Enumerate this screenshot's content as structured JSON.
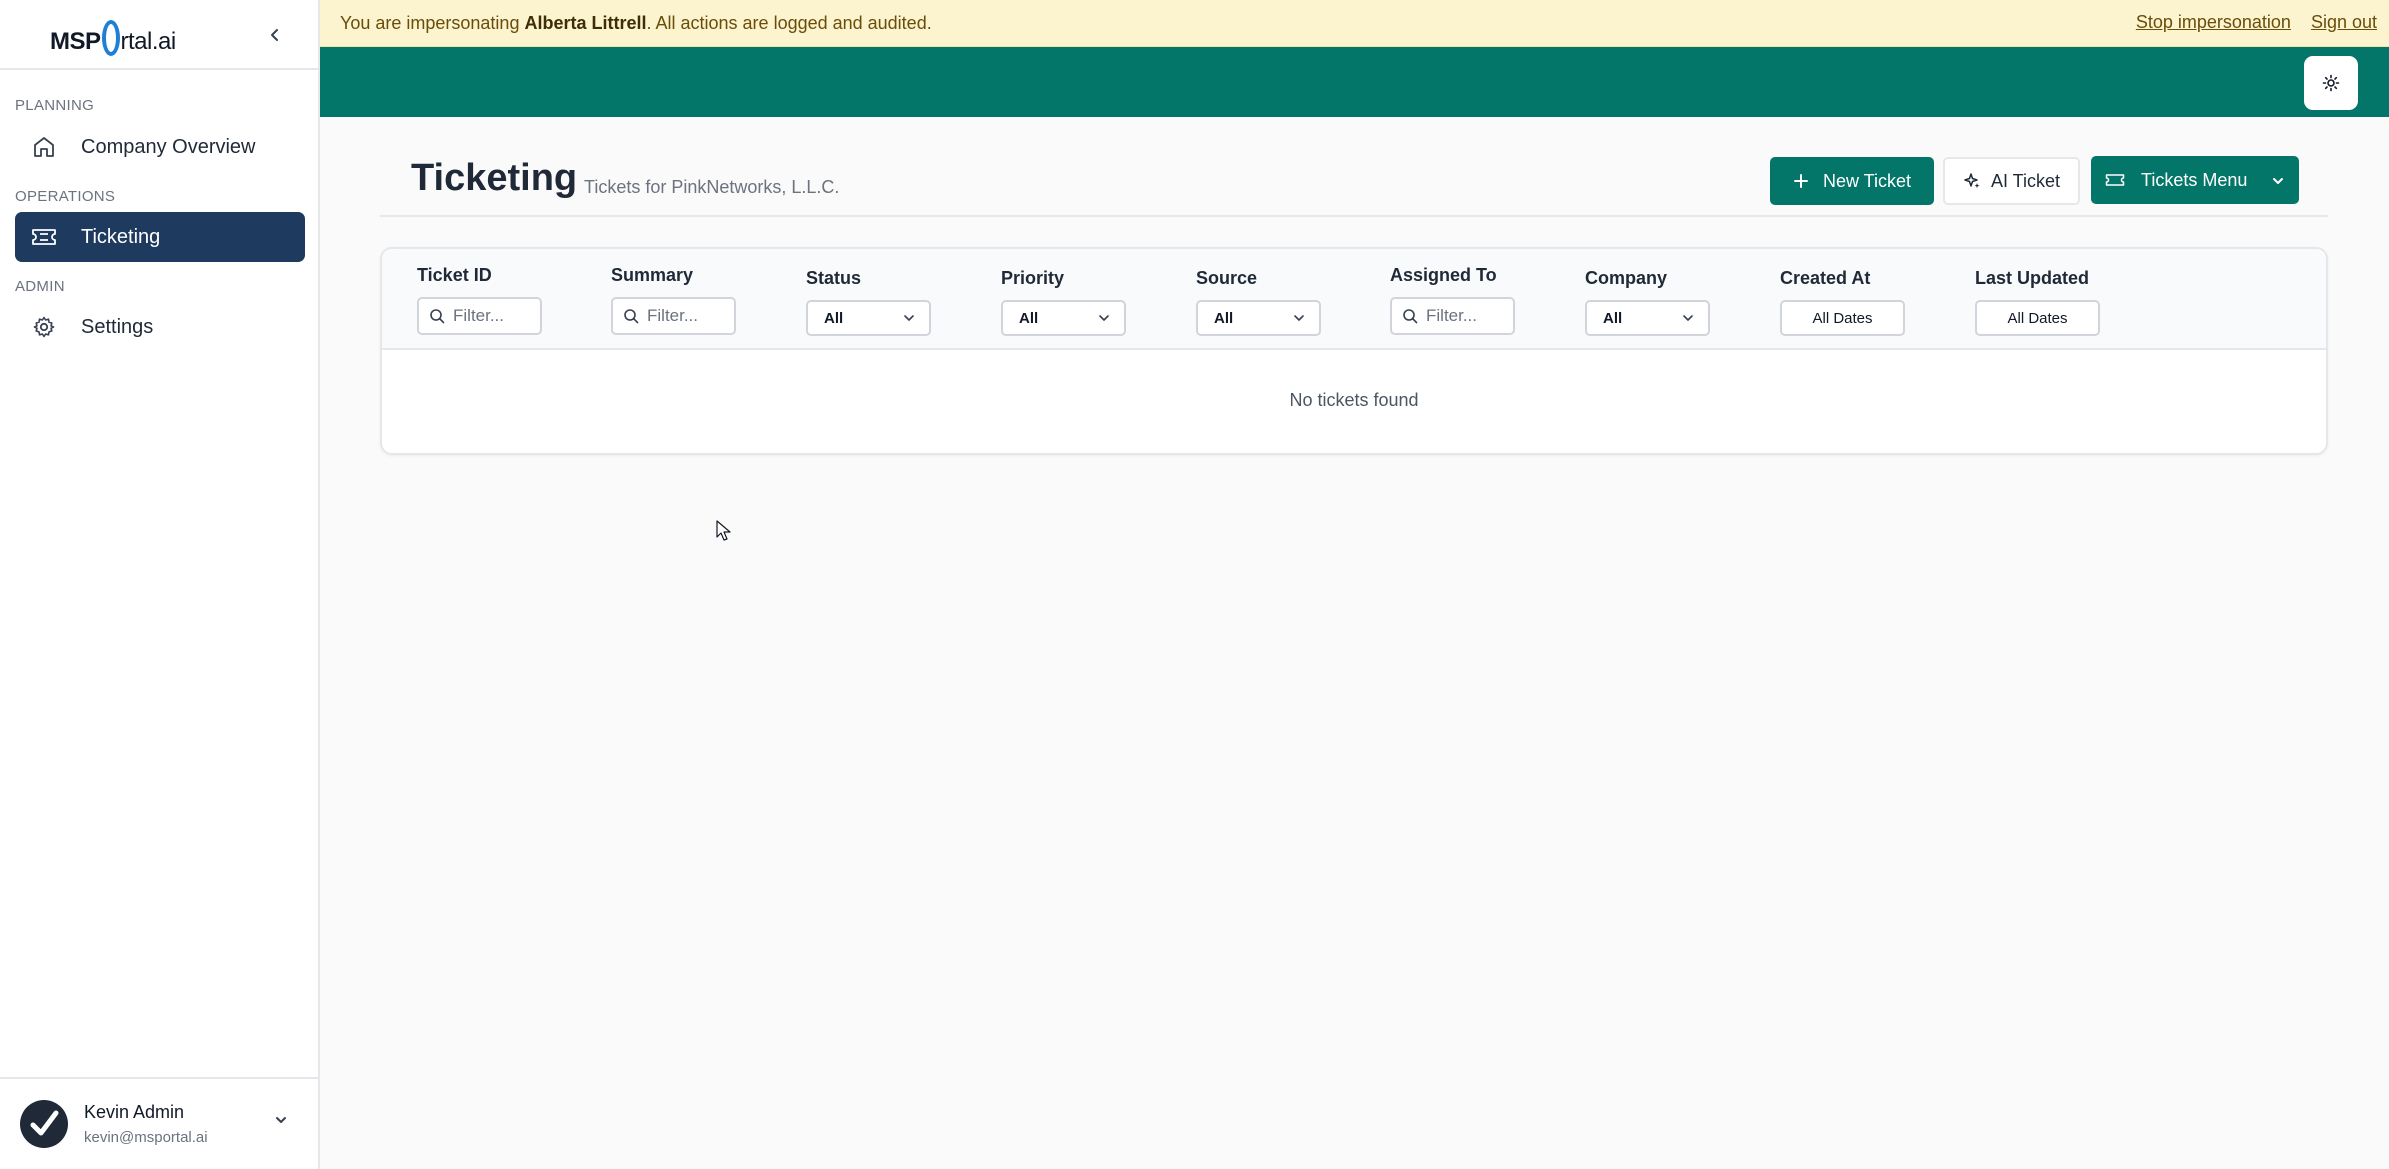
{
  "sidebar": {
    "logo": {
      "prefix": "MSP",
      "rest": "rtal.ai"
    },
    "sections": [
      {
        "label": "PLANNING",
        "items": [
          {
            "label": "Company Overview",
            "icon": "home-icon"
          }
        ]
      },
      {
        "label": "OPERATIONS",
        "items": [
          {
            "label": "Ticketing",
            "icon": "ticket-icon",
            "active": true
          }
        ]
      },
      {
        "label": "ADMIN",
        "items": [
          {
            "label": "Settings",
            "icon": "gear-icon"
          }
        ]
      }
    ],
    "user": {
      "name": "Kevin Admin",
      "email": "kevin@msportal.ai"
    }
  },
  "banner": {
    "prefix": "You are impersonating ",
    "name": "Alberta Littrell",
    "suffix": ". All actions are logged and audited.",
    "stop_label": "Stop impersonation",
    "signout_label": "Sign out"
  },
  "header": {
    "title": "Ticketing",
    "subtitle": "Tickets for PinkNetworks, L.L.C.",
    "new_ticket_label": "New Ticket",
    "ai_ticket_label": "AI Ticket",
    "tickets_menu_label": "Tickets Menu"
  },
  "table": {
    "columns": [
      {
        "label": "Ticket ID",
        "filter": "text",
        "placeholder": "Filter..."
      },
      {
        "label": "Summary",
        "filter": "text",
        "placeholder": "Filter..."
      },
      {
        "label": "Status",
        "filter": "select",
        "value": "All"
      },
      {
        "label": "Priority",
        "filter": "select",
        "value": "All"
      },
      {
        "label": "Source",
        "filter": "select",
        "value": "All"
      },
      {
        "label": "Assigned To",
        "filter": "text",
        "placeholder": "Filter..."
      },
      {
        "label": "Company",
        "filter": "select",
        "value": "All"
      },
      {
        "label": "Created At",
        "filter": "date",
        "value": "All Dates"
      },
      {
        "label": "Last Updated",
        "filter": "date",
        "value": "All Dates"
      }
    ],
    "empty_message": "No tickets found"
  },
  "colors": {
    "brand_teal": "#047569",
    "sidebar_active": "#1e3a5f",
    "banner_bg": "#fcf3cf",
    "logo_ring": "#1e7fd6"
  }
}
